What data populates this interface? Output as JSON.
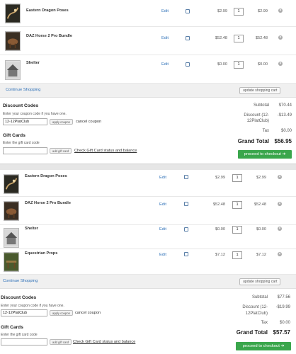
{
  "cart_a": {
    "items": [
      {
        "name": "Eastern Dragon Poses",
        "edit": "Edit",
        "price": "$2.99",
        "qty": "1",
        "total": "$2.99"
      },
      {
        "name": "DAZ Horse 2 Pro Bundle",
        "edit": "Edit",
        "price": "$52.48",
        "qty": "1",
        "total": "$52.48"
      },
      {
        "name": "Shelter",
        "edit": "Edit",
        "price": "$0.00",
        "qty": "1",
        "total": "$0.00"
      }
    ],
    "continue_label": "Continue Shopping",
    "update_label": "update shopping cart",
    "discount": {
      "heading": "Discount Codes",
      "hint": "Enter your coupon code if you have one.",
      "code": "12-12PlatClub",
      "apply_label": "apply coupon",
      "cancel_label": "cancel coupon"
    },
    "gift": {
      "heading": "Gift Cards",
      "hint": "Enter the gift card code",
      "value": "",
      "add_label": "add gift card",
      "check_label": "Check Gift Card status and balance"
    },
    "summary": {
      "subtotal_label": "Subtotal",
      "subtotal": "$70.44",
      "discount_label_1": "Discount (12-",
      "discount_label_2": "12PlatClub)",
      "discount": "-$13.49",
      "tax_label": "Tax",
      "tax": "$0.00",
      "grand_label": "Grand Total",
      "grand": "$56.95"
    },
    "checkout_label": "proceed to checkout ➔"
  },
  "cart_b": {
    "items": [
      {
        "name": "Eastern Dragon Poses",
        "edit": "Edit",
        "price": "$2.99",
        "qty": "1",
        "total": "$2.99"
      },
      {
        "name": "DAZ Horse 2 Pro Bundle",
        "edit": "Edit",
        "price": "$52.48",
        "qty": "1",
        "total": "$52.48"
      },
      {
        "name": "Shelter",
        "edit": "Edit",
        "price": "$0.00",
        "qty": "1",
        "total": "$0.00"
      },
      {
        "name": "Equestrian Props",
        "edit": "Edit",
        "price": "$7.12",
        "qty": "1",
        "total": "$7.12"
      }
    ],
    "continue_label": "Continue Shopping",
    "update_label": "update shopping cart",
    "discount": {
      "heading": "Discount Codes",
      "hint": "Enter your coupon code if you have one.",
      "code": "12-12PlatClub",
      "apply_label": "apply coupon",
      "cancel_label": "cancel coupon"
    },
    "gift": {
      "heading": "Gift Cards",
      "hint": "Enter the gift card code",
      "value": "",
      "add_label": "add gift card",
      "check_label": "Check Gift Card status and balance"
    },
    "summary": {
      "subtotal_label": "Subtotal",
      "subtotal": "$77.56",
      "discount_label_1": "Discount (12-",
      "discount_label_2": "12PlatClub)",
      "discount": "-$19.99",
      "tax_label": "Tax",
      "tax": "$0.00",
      "grand_label": "Grand Total",
      "grand": "$57.57"
    },
    "checkout_label": "proceed to checkout ➔"
  },
  "icons": {
    "remove": "remove-icon",
    "checkbox": "checkbox-icon",
    "thumbnail": "product-thumbnail"
  }
}
